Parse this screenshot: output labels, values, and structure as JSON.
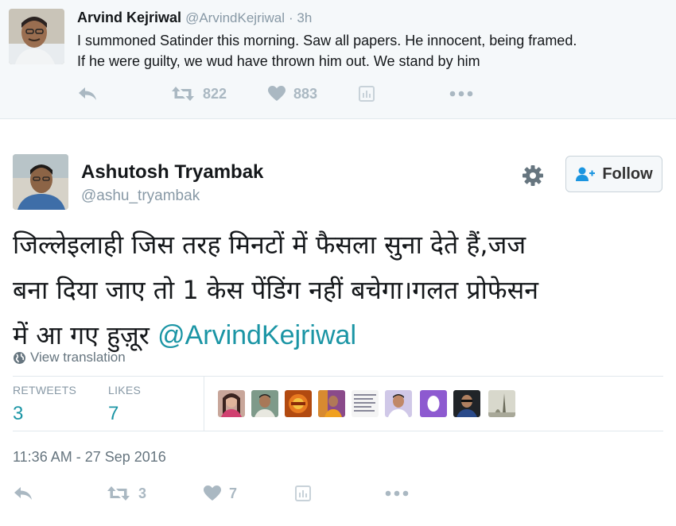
{
  "parent_tweet": {
    "name": "Arvind Kejriwal",
    "handle": "@ArvindKejriwal",
    "time": "· 3h",
    "text_line1": "I summoned Satinder this morning. Saw all papers. He innocent, being framed.",
    "text_line2": "If he were guilty, we wud have thrown him out. We stand by him",
    "retweets": "822",
    "likes": "883"
  },
  "tweet": {
    "name": "Ashutosh Tryambak",
    "handle": "@ashu_tryambak",
    "follow_label": "Follow",
    "text_line1": "जिल्लेइलाही जिस तरह मिनटों में फैसला सुना देते हैं,जज",
    "text_line2": "बना दिया जाए तो 1 केस पेंडिंग नहीं बचेगा।गलत प्रोफेसन",
    "text_line3": "में आ गए हुज़ूर ",
    "mention": "@ArvindKejriwal",
    "view_translation": "View translation",
    "retweets_label": "RETWEETS",
    "retweets_value": "3",
    "likes_label": "LIKES",
    "likes_value": "7",
    "timestamp": "11:36 AM - 27 Sep 2016",
    "action_retweets": "3",
    "action_likes": "7"
  },
  "colors": {
    "accent": "#1b95a5",
    "muted": "#8899a6",
    "icon": "#aab8c2"
  },
  "icons": [
    "reply-icon",
    "retweet-icon",
    "heart-icon",
    "analytics-icon",
    "more-icon",
    "gear-icon",
    "follow-person-icon",
    "globe-icon"
  ]
}
